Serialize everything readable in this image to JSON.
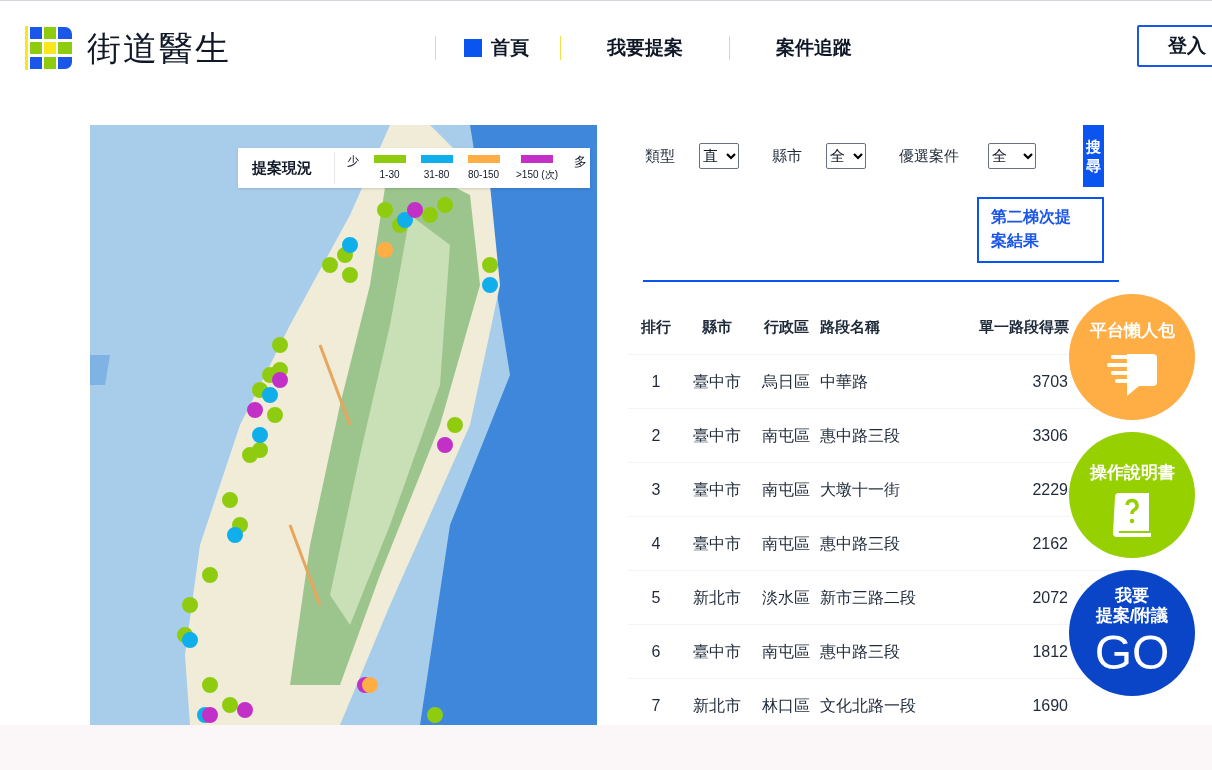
{
  "header": {
    "logo_text": "街道醫生",
    "nav": [
      {
        "label": "首頁",
        "selected": true
      },
      {
        "label": "我要提案",
        "selected": false
      },
      {
        "label": "案件追蹤",
        "selected": false
      }
    ],
    "login": "登入"
  },
  "map": {
    "kind": "picture",
    "legend": {
      "title": "提案現況",
      "low": "少",
      "high": "多",
      "items": [
        {
          "label": "1-30",
          "color": "#8fcc10"
        },
        {
          "label": "31-80",
          "color": "#10aeea"
        },
        {
          "label": "80-150",
          "color": "#ffad45"
        },
        {
          "label": ">150 (次)",
          "color": "#c230c8"
        }
      ]
    }
  },
  "filters": [
    {
      "label": "類型",
      "value": "直"
    },
    {
      "label": "縣市",
      "value": "全"
    },
    {
      "label": "優選案件",
      "value": "全"
    }
  ],
  "search_button": "搜尋",
  "second_round_link": "第二梯次提案結果",
  "table": {
    "columns": [
      "排行",
      "縣市",
      "行政區",
      "路段名稱",
      "單一路段得票"
    ],
    "rows": [
      [
        "1",
        "臺中市",
        "烏日區",
        "中華路",
        "3703"
      ],
      [
        "2",
        "臺中市",
        "南屯區",
        "惠中路三段",
        "3306"
      ],
      [
        "3",
        "臺中市",
        "南屯區",
        "大墩十一街",
        "2229"
      ],
      [
        "4",
        "臺中市",
        "南屯區",
        "惠中路三段",
        "2162"
      ],
      [
        "5",
        "新北市",
        "淡水區",
        "新市三路二段",
        "2072"
      ],
      [
        "6",
        "臺中市",
        "南屯區",
        "惠中路三段",
        "1812"
      ],
      [
        "7",
        "新北市",
        "林口區",
        "文化北路一段",
        "1690"
      ]
    ]
  },
  "floating_buttons": [
    {
      "kind": "guide",
      "label": "平台懶人包"
    },
    {
      "kind": "manual",
      "label": "操作說明書"
    },
    {
      "kind": "propose",
      "label": "我要",
      "sublabel": "提案/附議",
      "go": "GO"
    }
  ]
}
